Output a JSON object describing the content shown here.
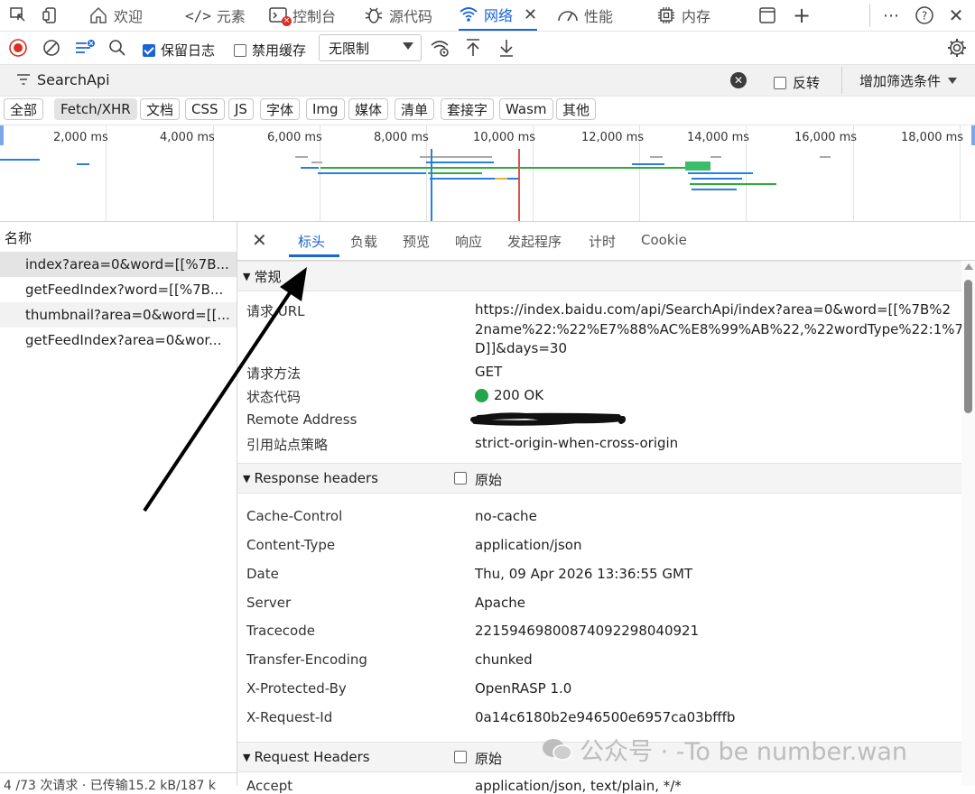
{
  "tabs": {
    "welcome": "欢迎",
    "elements": "元素",
    "console": "控制台",
    "sources": "源代码",
    "network": "网络",
    "performance": "性能",
    "memory": "内存"
  },
  "toolbar": {
    "preserve_log": "保留日志",
    "disable_cache": "禁用缓存",
    "throttle": "无限制"
  },
  "filter": {
    "value": "SearchApi",
    "invert": "反转",
    "more_filters": "增加筛选条件"
  },
  "types": [
    "全部",
    "Fetch/XHR",
    "文档",
    "CSS",
    "JS",
    "字体",
    "Img",
    "媒体",
    "清单",
    "套接字",
    "Wasm",
    "其他"
  ],
  "overview": {
    "ticks": [
      "2,000 ms",
      "4,000 ms",
      "6,000 ms",
      "8,000 ms",
      "10,000 ms",
      "12,000 ms",
      "14,000 ms",
      "16,000 ms",
      "18,000 ms"
    ]
  },
  "list": {
    "header": "名称",
    "rows": [
      "index?area=0&word=[[%7B...",
      "getFeedIndex?word=[[%7B...",
      "thumbnail?area=0&word=[[...",
      "getFeedIndex?area=0&wor..."
    ],
    "status": "4 /73 次请求 · 已传输15.2 kB/187 k"
  },
  "detail_tabs": [
    "标头",
    "负载",
    "预览",
    "响应",
    "发起程序",
    "计时",
    "Cookie"
  ],
  "general": {
    "title": "常规",
    "request_url_label": "请求 URL",
    "request_url_lines": [
      "https://index.baidu.com/api/SearchApi/index?area=0&word=[[%7B%2",
      "2name%22:%22%E7%88%AC%E8%99%AB%22,%22wordType%22:1%7",
      "D]]&days=30"
    ],
    "method_label": "请求方法",
    "method": "GET",
    "status_label": "状态代码",
    "status": "200 OK",
    "remote_label": "Remote Address",
    "policy_label": "引用站点策略",
    "policy": "strict-origin-when-cross-origin"
  },
  "response_headers": {
    "title": "Response headers",
    "raw": "原始",
    "rows": [
      {
        "k": "Cache-Control",
        "v": "no-cache"
      },
      {
        "k": "Content-Type",
        "v": "application/json"
      },
      {
        "k": "Date",
        "v": "Thu, 09 Apr 2026 13:36:55 GMT"
      },
      {
        "k": "Server",
        "v": "Apache"
      },
      {
        "k": "Tracecode",
        "v": "22159469800874092298040921"
      },
      {
        "k": "Transfer-Encoding",
        "v": "chunked"
      },
      {
        "k": "X-Protected-By",
        "v": "OpenRASP 1.0"
      },
      {
        "k": "X-Request-Id",
        "v": "0a14c6180b2e946500e6957ca03bfffb"
      }
    ]
  },
  "request_headers": {
    "title": "Request Headers",
    "raw": "原始",
    "partial_key": "Accept",
    "partial_value": "application/json, text/plain, */*"
  },
  "watermark": "公众号 · -To be number.wan",
  "colors": {
    "accent": "#1a64d6",
    "status_ok": "#23a54a",
    "record": "#d93025"
  }
}
